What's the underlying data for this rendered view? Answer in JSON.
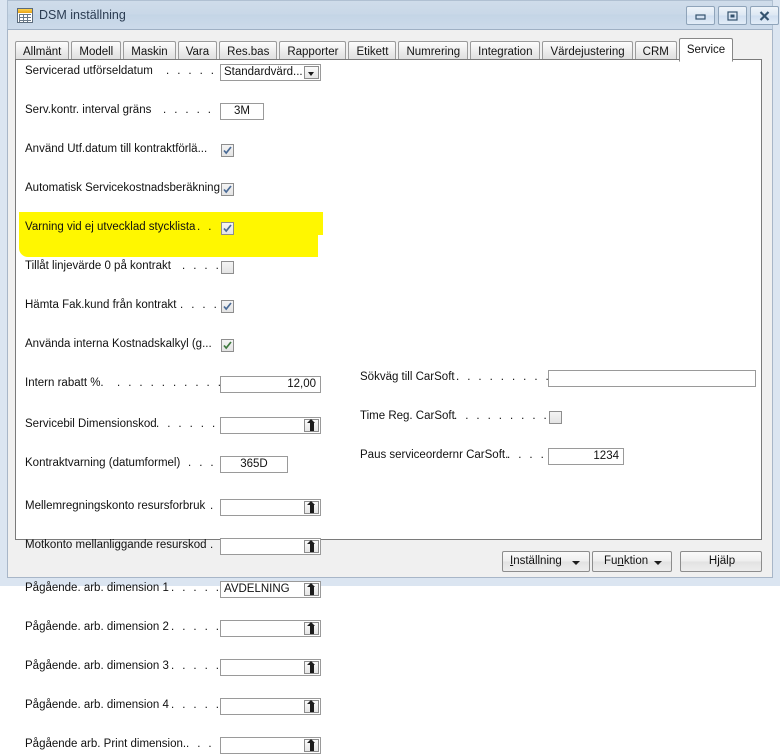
{
  "window": {
    "title": "DSM inställning",
    "icon": "table-grid-icon",
    "controls": {
      "minimize": "minimize-icon",
      "restore": "restore-icon",
      "close": "close-icon"
    }
  },
  "tabs": [
    {
      "label": "Allmänt",
      "active": false
    },
    {
      "label": "Modell",
      "active": false
    },
    {
      "label": "Maskin",
      "active": false
    },
    {
      "label": "Vara",
      "active": false
    },
    {
      "label": "Res.bas",
      "active": false
    },
    {
      "label": "Rapporter",
      "active": false
    },
    {
      "label": "Etikett",
      "active": false
    },
    {
      "label": "Numrering",
      "active": false
    },
    {
      "label": "Integration",
      "active": false
    },
    {
      "label": "Värdejustering",
      "active": false
    },
    {
      "label": "CRM",
      "active": false
    },
    {
      "label": "Service",
      "active": true
    }
  ],
  "left_column": [
    {
      "label": "Servicerad utförseldatum",
      "leader": ". . . . . .",
      "control": "dropdown",
      "value": "Standardvärd...",
      "name": "servicerad-utforseldatum"
    },
    {
      "label": "Serv.kontr. interval gräns",
      "leader": ". . . . . .",
      "control": "text",
      "value": "3M",
      "name": "serv-kontr-interval-grans"
    },
    {
      "label": "Använd Utf.datum till kontraktförlä...",
      "leader": "",
      "control": "checkbox",
      "checked": true,
      "name": "anvand-utf-datum-till-kontraktforlangning"
    },
    {
      "label": "Automatisk Servicekostnadsberäkning",
      "leader": "",
      "control": "checkbox",
      "checked": true,
      "name": "automatisk-servicekostnadsberakning"
    },
    {
      "label": "Varning vid ej utvecklad stycklista",
      "leader": ". .",
      "control": "checkbox",
      "checked": true,
      "name": "varning-vid-ej-utvecklad-stycklista"
    },
    {
      "label": "Tillåt linjevärde 0 på kontrakt",
      "leader": ". . . .",
      "control": "checkbox",
      "checked": false,
      "name": "tillat-linjevarde-0-pa-kontrakt"
    },
    {
      "label": "Hämta Fak.kund från kontrakt",
      "leader": ". . . .",
      "control": "checkbox",
      "checked": true,
      "name": "hamta-fak-kund-fran-kontrakt"
    },
    {
      "label": "Använda interna Kostnadskalkyl (g...",
      "leader": "",
      "control": "checkbox",
      "checked": true,
      "highlighted": true,
      "name": "anvanda-interna-kostnadskalkyl"
    },
    {
      "label": "Intern rabatt %.",
      "leader": ". . . . . . . . . .",
      "control": "text",
      "value": "12,00",
      "highlighted": true,
      "name": "intern-rabatt-procent"
    },
    {
      "label": "Servicebil Dimensionskod",
      "leader": ". . . . . . .",
      "control": "lookup",
      "value": "",
      "name": "servicebil-dimensionskod"
    },
    {
      "label": "Kontraktvarning (datumformel)",
      "leader": ". . .",
      "control": "text",
      "value": "365D",
      "name": "kontraktvarning-datumformel"
    },
    {
      "label": "Mellemregningskonto resursforbruk",
      "leader": ".",
      "control": "lookup",
      "value": "",
      "name": "mellemregningskonto-resursforbruk"
    },
    {
      "label": "Motkonto mellanliggande resurskod",
      "leader": ".",
      "control": "lookup",
      "value": "",
      "name": "motkonto-mellanliggande-resurskod"
    },
    {
      "label": "Pågående. arb. dimension 1",
      "leader": ". . . . .",
      "control": "lookup",
      "value": "AVDELNING",
      "name": "pagaende-arb-dimension-1"
    },
    {
      "label": "Pågående. arb. dimension 2",
      "leader": ". . . . .",
      "control": "lookup",
      "value": "",
      "name": "pagaende-arb-dimension-2"
    },
    {
      "label": "Pågående. arb. dimension 3",
      "leader": ". . . . .",
      "control": "lookup",
      "value": "",
      "name": "pagaende-arb-dimension-3"
    },
    {
      "label": "Pågående. arb. dimension 4",
      "leader": ". . . . .",
      "control": "lookup",
      "value": "",
      "name": "pagaende-arb-dimension-4"
    },
    {
      "label": "Pågående arb. Print dimension.",
      "leader": ". . . .",
      "control": "lookup",
      "value": "",
      "name": "pagaende-arb-print-dimension"
    }
  ],
  "right_column": [
    {
      "label": "Sökväg till CarSoft",
      "leader": ". . . . . . . . .",
      "control": "text-wide",
      "value": "",
      "name": "sokvag-till-carsoft"
    },
    {
      "label": "Time Reg. CarSoft",
      "leader": ". . . . . . . . .",
      "control": "checkbox",
      "checked": false,
      "name": "time-reg-carsoft"
    },
    {
      "label": "Paus serviceordernr CarSoft.",
      "leader": ". . . .",
      "control": "text",
      "value": "1234",
      "name": "paus-serviceordernr-carsoft"
    }
  ],
  "footer": {
    "buttons": [
      {
        "label": "Inställning",
        "accel": "I",
        "accel_index": 0,
        "dropdown": true,
        "name": "installning-button"
      },
      {
        "label": "Funktion",
        "accel": "n",
        "accel_index": 2,
        "dropdown": true,
        "name": "funktion-button"
      },
      {
        "label": "Hjälp",
        "accel": "j",
        "accel_index": 2,
        "dropdown": false,
        "name": "hjalp-button"
      }
    ]
  },
  "colors": {
    "titlebar": "#ccdaea",
    "window_bg": "#dbe5f1",
    "panel_bg": "#ffffff",
    "footer_bg": "#f0f0f0",
    "highlight": "#fff700",
    "checkmark": "#4a6b96"
  }
}
